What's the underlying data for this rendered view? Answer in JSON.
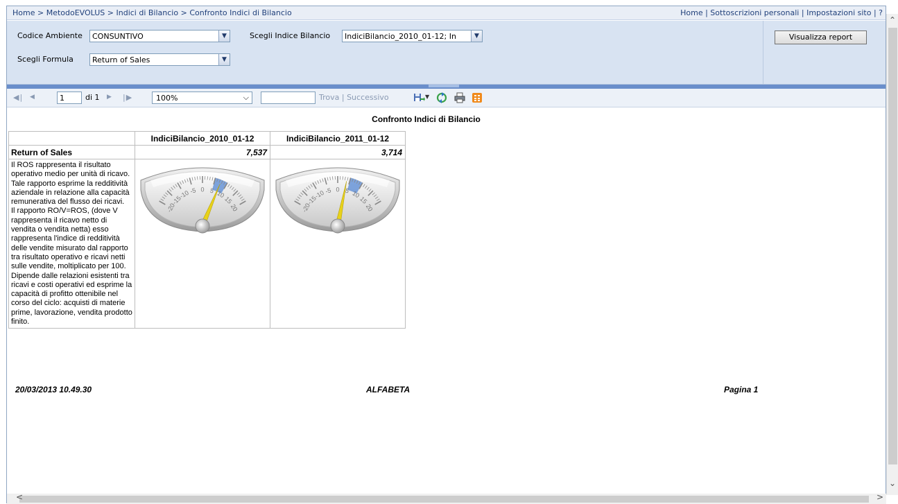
{
  "breadcrumb": {
    "items": [
      "Home",
      "MetodoEVOLUS",
      "Indici di Bilancio",
      "Confronto Indici di Bilancio"
    ],
    "separator": " > "
  },
  "top_links": [
    "Home",
    "Sottoscrizioni personali",
    "Impostazioni sito",
    "?"
  ],
  "params": {
    "ambiente_label": "Codice Ambiente",
    "ambiente_value": "CONSUNTIVO",
    "indice_label": "Scegli Indice Bilancio",
    "indice_value": "IndiciBilancio_2010_01-12; In",
    "formula_label": "Scegli Formula",
    "formula_value": "Return of Sales",
    "view_button": "Visualizza report"
  },
  "toolbar": {
    "page_value": "1",
    "page_of": "di 1",
    "zoom_value": "100%",
    "find_value": "",
    "find_label": "Trova",
    "next_label": "Successivo"
  },
  "report": {
    "title": "Confronto Indici di Bilancio",
    "columns": [
      "IndiciBilancio_2010_01-12",
      "IndiciBilancio_2011_01-12"
    ],
    "row_label": "Return of Sales",
    "values": [
      "7,537",
      "3,714"
    ],
    "description": "Il ROS rappresenta il risultato operativo medio per unità di ricavo. Tale rapporto esprime la redditività aziendale in relazione alla capacità remunerativa del flusso dei ricavi.\nIl rapporto RO/V=ROS, (dove V rappresenta il ricavo netto di vendita o vendita netta) esso rappresenta l'indice di redditività delle vendite misurato dal rapporto tra risultato operativo e ricavi netti sulle vendite, moltiplicato per 100. Dipende dalle relazioni esistenti tra ricavi e costi operativi ed esprime la capacità di profitto ottenibile nel corso del ciclo: acquisti di materie prime, lavorazione, vendita prodotto finito.",
    "gauge_ticks": [
      "-20",
      "-15",
      "-10",
      "-5",
      "0",
      "5",
      "10",
      "15",
      "20"
    ],
    "gauge_values": [
      7.537,
      3.714
    ],
    "footer_date": "20/03/2013 10.49.30",
    "footer_company": "ALFABETA",
    "footer_page": "Pagina 1"
  },
  "colors": {
    "link": "#1f3f7a",
    "param_bg": "#d8e3f2",
    "splitter": "#6a8ecb",
    "needle": "#e8d21a",
    "target_zone": "#5f8fd6"
  }
}
